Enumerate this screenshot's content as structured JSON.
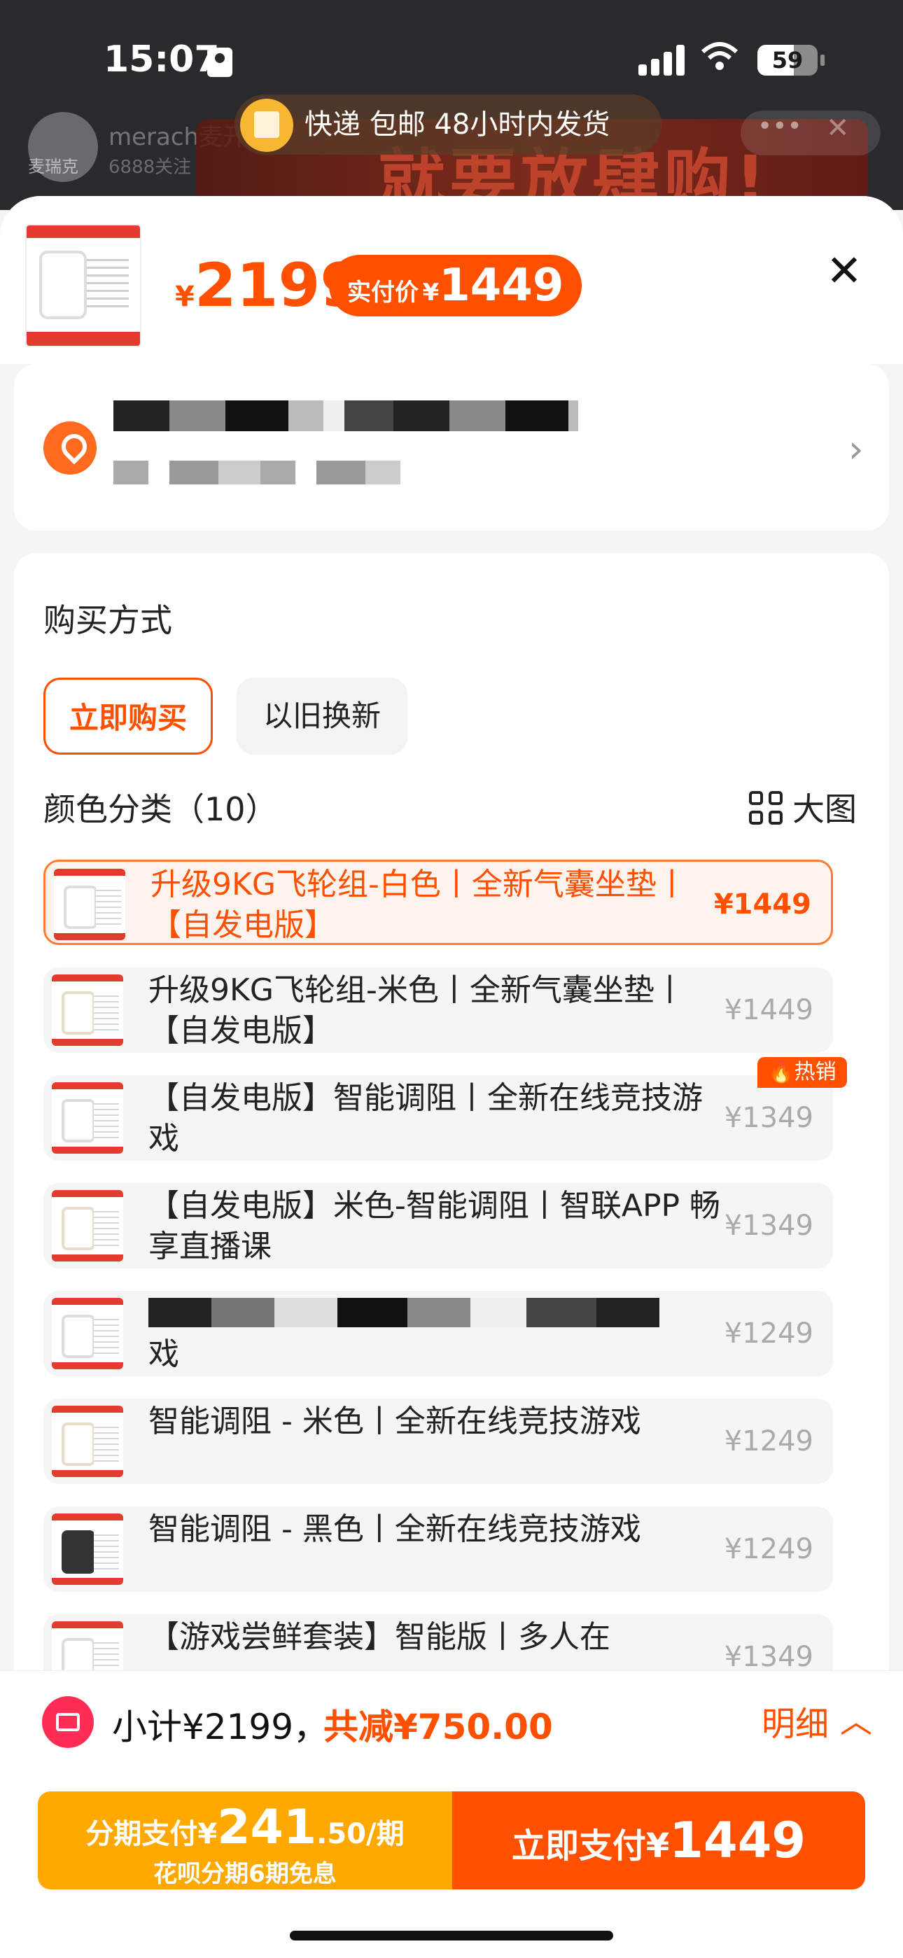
{
  "status_bar": {
    "time": "15:07",
    "battery": "59"
  },
  "background": {
    "store_name": "merach麦开",
    "store_logo_text": "麦瑞克",
    "followers": "6888关注",
    "banner_text": "就要放肆购!"
  },
  "toast": {
    "text": "快递 包邮 48小时内发货"
  },
  "header": {
    "currency": "¥",
    "original_price": "2199",
    "actual_label": "实付价",
    "actual_currency": "¥",
    "actual_price": "1449"
  },
  "purchase": {
    "title": "购买方式",
    "mode_active": "立即购买",
    "mode_inactive": "以旧换新"
  },
  "colors": {
    "title": "颜色分类（10）",
    "bigview_label": "大图",
    "hot_label": "热销",
    "options": [
      {
        "text": "升级9KG飞轮组-白色丨全新气囊坐垫丨【自发电版】",
        "price": "¥1449"
      },
      {
        "text": "升级9KG飞轮组-米色丨全新气囊坐垫丨【自发电版】",
        "price": "¥1449"
      },
      {
        "text": "【自发电版】智能调阻丨全新在线竞技游戏",
        "price": "¥1349"
      },
      {
        "text": "【自发电版】米色-智能调阻丨智联APP 畅享直播课",
        "price": "¥1349"
      },
      {
        "text": "戏",
        "price": "¥1249"
      },
      {
        "text": "智能调阻 - 米色丨全新在线竞技游戏",
        "price": "¥1249"
      },
      {
        "text": "智能调阻 - 黑色丨全新在线竞技游戏",
        "price": "¥1249"
      },
      {
        "text": "【游戏尝鲜套装】智能版丨多人在",
        "price": "¥1349"
      }
    ]
  },
  "bottom": {
    "subtotal": "小计¥2199，",
    "discount": "共减¥750.00",
    "detail": "明细",
    "install_prefix": "分期支付¥",
    "install_big": "241",
    "install_suffix": ".50/期",
    "install_sub": "花呗分期6期免息",
    "pay_label": "立即支付¥",
    "pay_value": "1449"
  },
  "colors_theme": {
    "accent": "#ff5000",
    "install": "#ffa800"
  }
}
